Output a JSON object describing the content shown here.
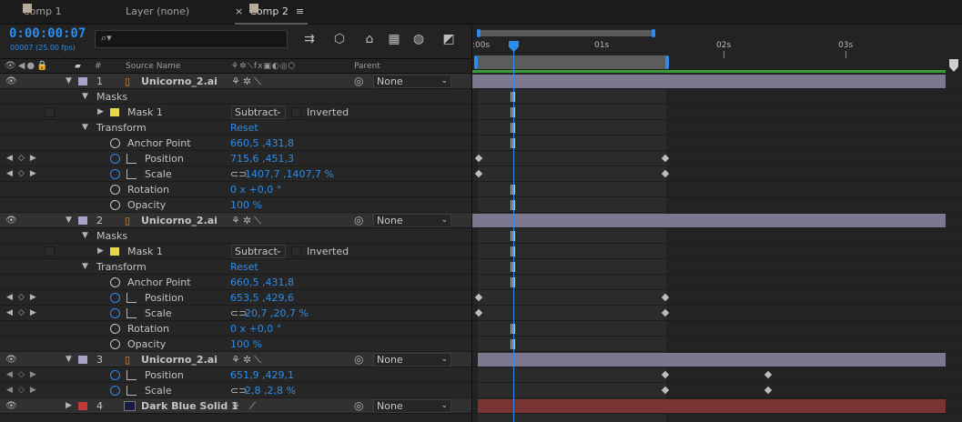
{
  "tabs": [
    {
      "label": "Comp 1",
      "swatch": "#b7ac99"
    },
    {
      "label": "Layer  (none)"
    },
    {
      "label": "Comp 2",
      "swatch": "#b7ac99",
      "close": "×",
      "menu": "≡"
    }
  ],
  "timecode": "0:00:00:07",
  "frame_info": "00007 (25.00 fps)",
  "search": {
    "value": "",
    "icon": "search-icon"
  },
  "columns": {
    "hash": "#",
    "source_name": "Source Name",
    "parent": "Parent"
  },
  "ruler": {
    "ticks": [
      ":00s",
      "01s",
      "02s",
      "03s"
    ]
  },
  "layers": [
    {
      "num": "1",
      "name": "Unicorno_2.ai",
      "label_color": "#a9a3c7",
      "parent": "None"
    },
    {
      "num": "2",
      "name": "Unicorno_2.ai",
      "label_color": "#a9a3c7",
      "parent": "None"
    },
    {
      "num": "3",
      "name": "Unicorno_2.ai",
      "label_color": "#a9a3c7",
      "parent": "None"
    },
    {
      "num": "4",
      "name": "Dark Blue Solid 1",
      "label_color": "#c03a3a",
      "parent": "None"
    }
  ],
  "props": {
    "masks": "Masks",
    "mask1": "Mask 1",
    "mask_mode": "Subtract",
    "inverted": "Inverted",
    "transform": "Transform",
    "reset": "Reset",
    "anchor": "Anchor Point",
    "position": "Position",
    "scale": "Scale",
    "rotation": "Rotation",
    "opacity": "Opacity"
  },
  "values": {
    "l1_anchor": "660,5 ,431,8",
    "l1_position": "715,6 ,451,3",
    "l1_scale": "1407,7 ,1407,7 %",
    "l1_rotation": "0 x +0,0 °",
    "l1_opacity": "100 %",
    "l2_anchor": "660,5 ,431,8",
    "l2_position": "653,5 ,429,6",
    "l2_scale": "20,7 ,20,7 %",
    "l2_rotation": "0 x +0,0 °",
    "l2_opacity": "100 %",
    "l3_position": "651,9 ,429,1",
    "l3_scale": "2,8 ,2,8 %"
  },
  "colors": {
    "accent": "#2d8ceb",
    "layer_bar": "#7d7890",
    "solid_bar": "#7a3434",
    "work_area": "#3a9c3a"
  }
}
